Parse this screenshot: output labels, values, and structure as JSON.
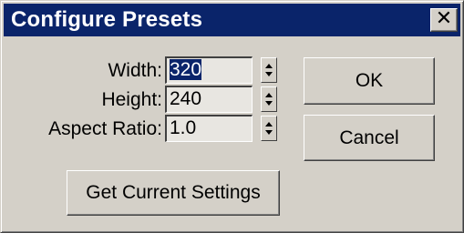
{
  "dialog": {
    "title": "Configure Presets",
    "close_glyph": "✕"
  },
  "fields": [
    {
      "label": "Width:",
      "value": "320",
      "selected": true
    },
    {
      "label": "Height:",
      "value": "240",
      "selected": false
    },
    {
      "label": "Aspect Ratio:",
      "value": "1.0",
      "selected": false
    }
  ],
  "buttons": {
    "ok": "OK",
    "cancel": "Cancel",
    "get_current": "Get Current Settings"
  },
  "colors": {
    "titlebar": "#0a246a",
    "face": "#d4d0c8",
    "selection": "#0a246a"
  }
}
